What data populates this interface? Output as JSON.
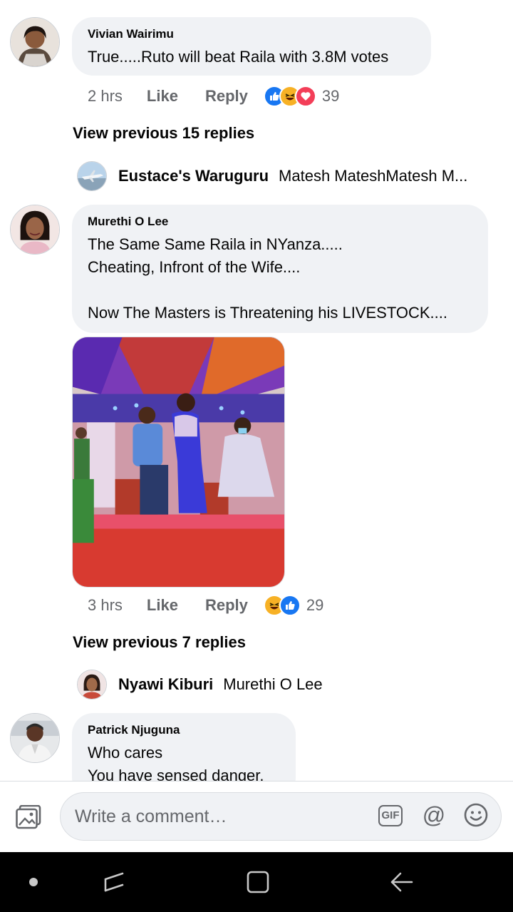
{
  "comments": [
    {
      "author": "Vivian Wairimu",
      "text": "True.....Ruto will beat Raila with 3.8M votes",
      "time": "2 hrs",
      "like_label": "Like",
      "reply_label": "Reply",
      "reactions": [
        "like",
        "haha",
        "love"
      ],
      "reaction_count": "39",
      "view_previous": "View previous 15 replies",
      "latest_reply": {
        "author": "Eustace's Waruguru",
        "text": "Matesh MateshMatesh M..."
      }
    },
    {
      "author": "Murethi O Lee",
      "text": "The Same Same Raila in NYanza.....\nCheating, Infront of the Wife....\n\nNow The Masters is Threatening his LIVESTOCK....",
      "time": "3 hrs",
      "like_label": "Like",
      "reply_label": "Reply",
      "reactions": [
        "haha",
        "like"
      ],
      "reaction_count": "29",
      "view_previous": "View previous 7 replies",
      "latest_reply": {
        "author": "Nyawi Kiburi",
        "text": "Murethi O Lee"
      }
    },
    {
      "author": "Patrick Njuguna",
      "text": "Who cares\nYou have sensed danger."
    }
  ],
  "composer": {
    "placeholder": "Write a comment…",
    "gif_label": "GIF",
    "at_label": "@"
  },
  "colors": {
    "bubble": "#f0f2f5",
    "secondary_text": "#65676b",
    "like_blue": "#1877f2",
    "haha_yellow": "#f7b125",
    "love_red": "#f33e58"
  }
}
